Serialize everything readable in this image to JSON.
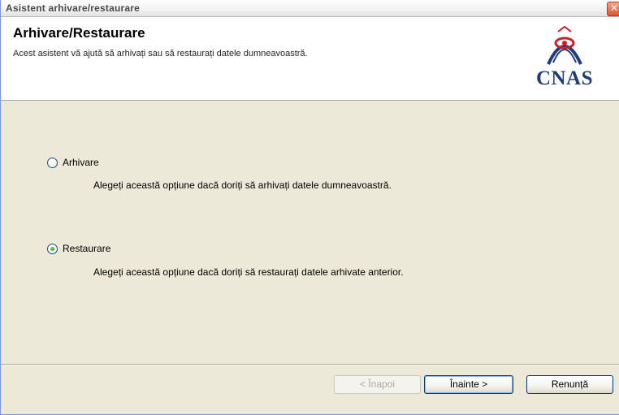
{
  "window": {
    "title": "Asistent arhivare/restaurare",
    "close_glyph": "✕"
  },
  "header": {
    "title": "Arhivare/Restaurare",
    "subtitle": "Acest asistent vă ajută să arhivați sau să restaurați datele dumneavoastră.",
    "logo_text": "CNAS"
  },
  "options": [
    {
      "label": "Arhivare",
      "description": "Alegeți această opțiune dacă doriți să arhivați datele dumneavoastră.",
      "checked": false
    },
    {
      "label": "Restaurare",
      "description": "Alegeți această opțiune dacă doriți să restaurați datele arhivate anterior.",
      "checked": true
    }
  ],
  "buttons": {
    "back_label": "< Înapoi",
    "next_label": "Înainte >",
    "cancel_label": "Renunță"
  },
  "colors": {
    "window_bg": "#ece9d8",
    "header_bg": "#ffffff",
    "logo_blue": "#1f3d7a",
    "logo_red": "#c8202b",
    "radio_check": "#169b16"
  }
}
